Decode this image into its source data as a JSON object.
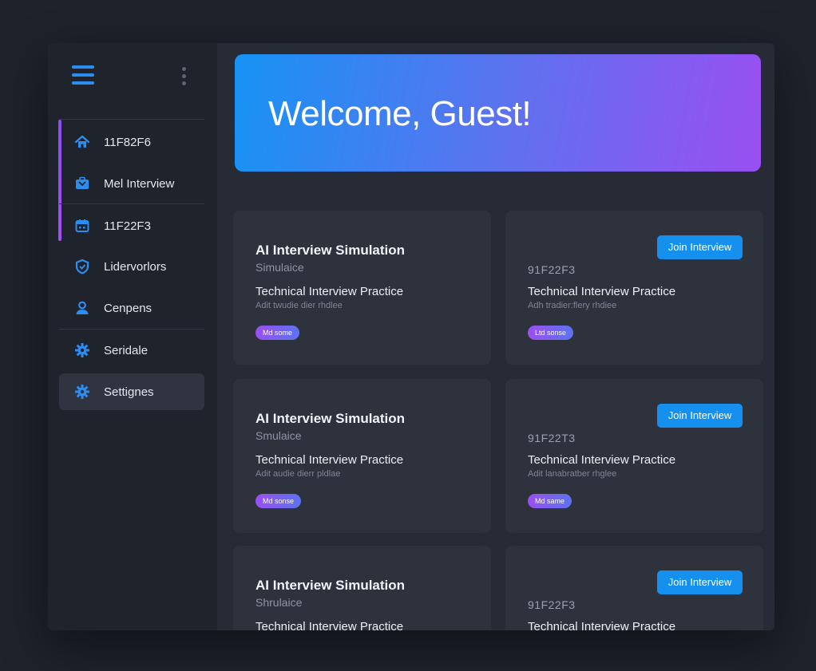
{
  "sidebar": {
    "items": [
      {
        "label": "11F82F6",
        "icon": "home-icon"
      },
      {
        "label": "Mel Interview",
        "icon": "briefcase-icon"
      },
      {
        "label": "11F22F3",
        "icon": "calendar-icon"
      },
      {
        "label": "Lidervorlors",
        "icon": "shield-icon"
      },
      {
        "label": "Cenpens",
        "icon": "user-icon"
      },
      {
        "label": "Seridale",
        "icon": "gear-icon"
      },
      {
        "label": "Settignes",
        "icon": "gear-icon"
      }
    ]
  },
  "hero": {
    "title": "Welcome, Guest!"
  },
  "cards": [
    {
      "title": "AI Interview Simulation",
      "subtitle": "Simulaice",
      "heading": "Technical Interview Practice",
      "desc": "Adit twudie dier rhdlee",
      "pill": "Md some"
    },
    {
      "button": "Join Interview",
      "code": "91F22F3",
      "heading": "Technical Interview Practice",
      "desc": "Adh tradier:flery rhdiee",
      "pill": "Ltd sonse"
    },
    {
      "title": "AI Interview Simulation",
      "subtitle": "Smulaice",
      "heading": "Technical Interview Practice",
      "desc": "Adit audie dierr pldlae",
      "pill": "Md sonse"
    },
    {
      "button": "Join Interview",
      "code": "91F22T3",
      "heading": "Technical Interview Practice",
      "desc": "Adit lanabratber rhglee",
      "pill": "Md same"
    },
    {
      "title": "AI Interview Simulation",
      "subtitle": "Shrulaice",
      "heading": "Technical Interview Practice"
    },
    {
      "button": "Join Interview",
      "code": "91F22F3",
      "heading": "Technical Interview Practice"
    }
  ],
  "colors": {
    "accent": "#1590ef",
    "gradient_start": "#1793f4",
    "gradient_end": "#9a4ff1",
    "icon_blue": "#2d8cf0"
  }
}
